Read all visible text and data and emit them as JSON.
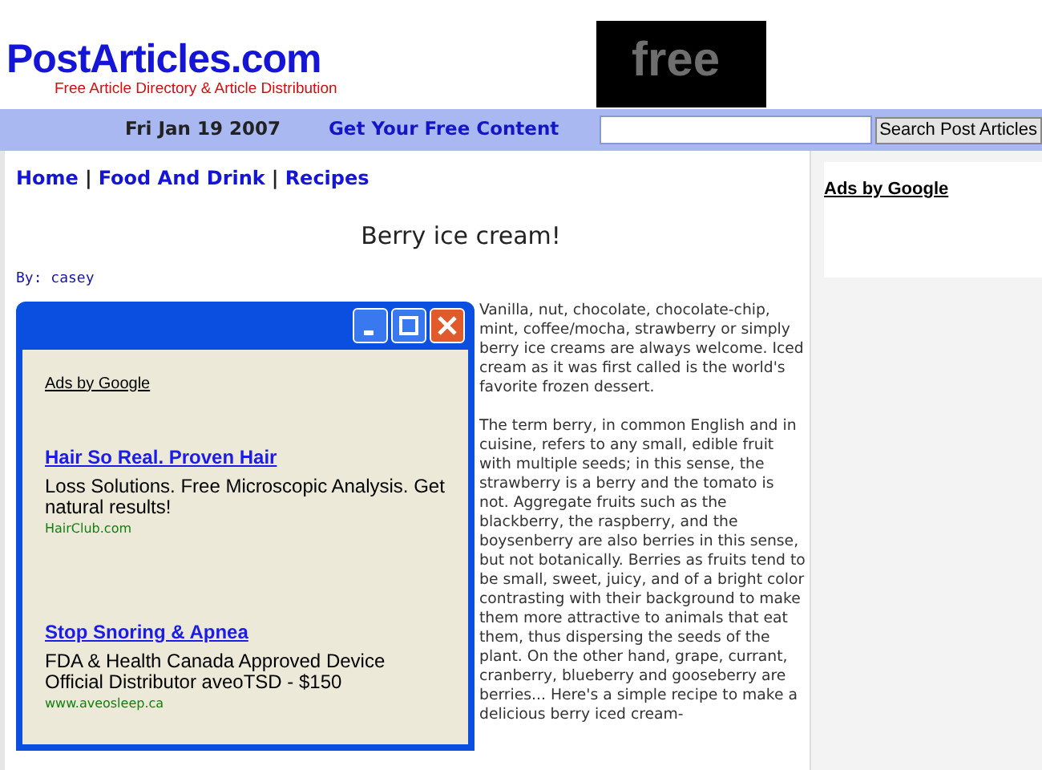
{
  "header": {
    "logo": {
      "name": "PostArticles.com",
      "tagline": "Free Article Directory & Article Distribution"
    },
    "banner": {
      "text": "free"
    }
  },
  "nav_bar": {
    "date": "Fri Jan 19 2007",
    "link": "Get Your Free Content",
    "search": {
      "button": "Search Post Articles"
    }
  },
  "breadcrumb": [
    {
      "label": "Home"
    },
    {
      "label": "Food And Drink"
    },
    {
      "label": "Recipes"
    }
  ],
  "breadcrumb_separator": "|",
  "article": {
    "title": "Berry ice cream!",
    "byline": "By: casey",
    "paragraphs": [
      "Vanilla, nut, chocolate, chocolate-chip, mint, coffee/mocha, strawberry or simply berry ice creams are always welcome. Iced cream as it was first called is the world's favorite frozen dessert.",
      "The term berry, in common English and in cuisine, refers to any small, edible fruit with multiple seeds; in this sense, the strawberry is a berry and the tomato is not. Aggregate fruits such as the blackberry, the raspberry, and the boysenberry are also berries in this sense, but not botanically. Berries as fruits tend to be small, sweet, juicy, and of a bright color contrasting with their background to make them more attractive to animals that eat them, thus dispersing the seeds of the plant. On the other hand, grape, currant, cranberry, blueberry and gooseberry are berries... Here's a simple recipe to make a delicious berry iced cream-"
    ]
  },
  "ad_window": {
    "heading": "Ads by Google",
    "ads": [
      {
        "title": "Hair So Real. Proven Hair",
        "text": "Loss Solutions. Free Microscopic Analysis. Get natural results!",
        "url": "HairClub.com"
      },
      {
        "title": "Stop Snoring & Apnea",
        "text": "FDA & Health Canada Approved Device Official Distributor aveoTSD - $150",
        "url": "www.aveosleep.ca"
      }
    ]
  },
  "sidebar": {
    "heading": "Ads by Google"
  }
}
